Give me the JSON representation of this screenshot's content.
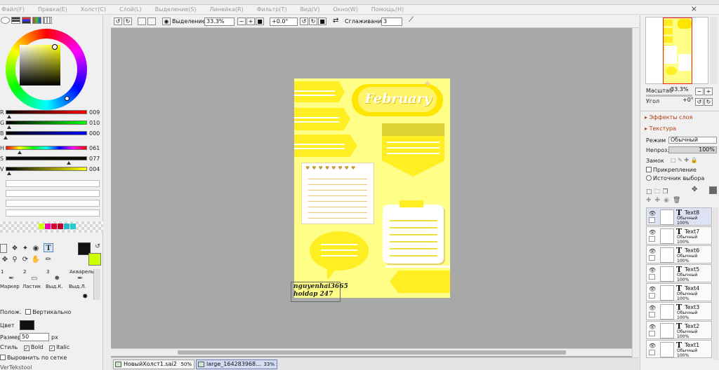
{
  "menu": [
    "Файл(F)",
    "Правка(E)",
    "Холст(C)",
    "Слой(L)",
    "Выделение(S)",
    "Линейка(R)",
    "Фильтр(T)",
    "Вид(V)",
    "Окно(W)",
    "Помощь(H)"
  ],
  "window_close": "×",
  "color_sliders": [
    {
      "label": "R",
      "value": "009",
      "from": "#000000",
      "to": "#ff0000",
      "pos": 0.04
    },
    {
      "label": "G",
      "value": "010",
      "from": "#000000",
      "to": "#00ff00",
      "pos": 0.04
    },
    {
      "label": "B",
      "value": "000",
      "from": "#000000",
      "to": "#0000ff",
      "pos": 0.0
    },
    {
      "label": "H",
      "value": "061",
      "pos": 0.17
    },
    {
      "label": "S",
      "value": "077",
      "pos": 0.78
    },
    {
      "label": "V",
      "value": "004",
      "pos": 0.04
    }
  ],
  "swatches": [
    "#ccff00",
    "#ee00aa",
    "#dd0033",
    "#bb0033",
    "#22bbcc",
    "#22cccc"
  ],
  "colors": {
    "foreground": "#111111",
    "secondary": "#ccff00",
    "canvas_bg": "#a8a8a8",
    "art_bg": "#ffff88",
    "accent_yellow": "#ffee22"
  },
  "brushes": [
    {
      "num": "1",
      "name": "Маркер",
      "icon": "marker-icon"
    },
    {
      "num": "2",
      "name": "Ластик",
      "icon": "eraser-icon"
    },
    {
      "num": "3",
      "name": "Выд.К.",
      "icon": "select-brush-icon"
    },
    {
      "num": "",
      "name": "Акварель",
      "icon": "watercolor-icon"
    },
    {
      "num": "",
      "name": "Выд.Л.",
      "icon": "deselect-brush-icon"
    }
  ],
  "text_tool": {
    "position_label": "Полож.",
    "vertical_label": "Вертикально",
    "color_label": "Цвет",
    "size_label": "Размер",
    "size_value": "50",
    "size_unit": "px",
    "style_label": "Стиль",
    "bold_label": "Bold",
    "italic_label": "Italic",
    "grid_label": "Выровнить по сетке",
    "grid_checked": false,
    "bold_checked": true,
    "italic_checked": true,
    "footer": "VerTekstool"
  },
  "toolbar": {
    "selection_label": "Выделение",
    "zoom": "33.3%",
    "rotation": "+0.0°",
    "smoothing_label": "Сглаживание",
    "smoothing_value": "3"
  },
  "artwork": {
    "title": "February"
  },
  "watermark": {
    "line1": "nguyenhai3665",
    "line2": "hoidap 247"
  },
  "tabs": [
    {
      "name": "НовыйХолст1.sai2",
      "zoom": "50%",
      "active": false
    },
    {
      "name": "large_164283968...",
      "zoom": "33%",
      "active": true
    }
  ],
  "navigator": {
    "scale_label": "Масштаб",
    "scale_value": "33.3%",
    "angle_label": "Угол",
    "angle_value": "+0°"
  },
  "layer_panel": {
    "effects_label": "Эффекты слоя",
    "texture_label": "Текстура",
    "mode_label": "Режим",
    "mode_value": "Обычный",
    "opacity_label": "Непроз.",
    "opacity_value": "100%",
    "lock_label": "Замок",
    "clip_label": "Прикрепление",
    "source_label": "Источник выбора"
  },
  "layers": [
    {
      "name": "Text8",
      "mode": "Обычный",
      "opacity": "100%",
      "selected": true
    },
    {
      "name": "Text7",
      "mode": "Обычный",
      "opacity": "100%",
      "selected": false
    },
    {
      "name": "Text6",
      "mode": "Обычный",
      "opacity": "100%",
      "selected": false
    },
    {
      "name": "Text5",
      "mode": "Обычный",
      "opacity": "100%",
      "selected": false
    },
    {
      "name": "Text4",
      "mode": "Обычный",
      "opacity": "100%",
      "selected": false
    },
    {
      "name": "Text3",
      "mode": "Обычный",
      "opacity": "100%",
      "selected": false
    },
    {
      "name": "Text2",
      "mode": "Обычный",
      "opacity": "100%",
      "selected": false
    },
    {
      "name": "Text1",
      "mode": "Обычный",
      "opacity": "100%",
      "selected": false
    }
  ]
}
